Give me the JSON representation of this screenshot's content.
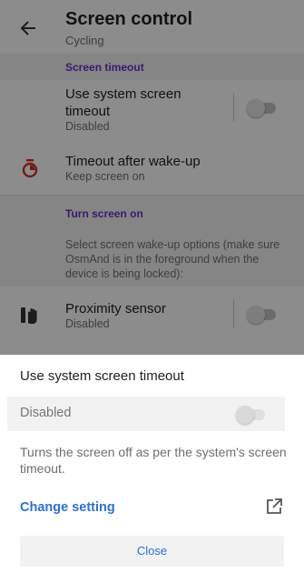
{
  "header": {
    "title": "Screen control",
    "subtitle": "Cycling"
  },
  "sections": {
    "screen_timeout": {
      "header": "Screen timeout",
      "use_system": {
        "title_line1": "Use system screen",
        "title_line2": "timeout",
        "status": "Disabled",
        "enabled": false
      },
      "timeout_after_wakeup": {
        "title": "Timeout after wake-up",
        "status": "Keep screen on"
      }
    },
    "turn_screen_on": {
      "header": "Turn screen on",
      "description": "Select screen wake-up options (make sure OsmAnd is in the foreground when the device is being locked):",
      "proximity": {
        "title": "Proximity sensor",
        "status": "Disabled",
        "enabled": false
      }
    }
  },
  "sheet": {
    "title": "Use system screen timeout",
    "row_label": "Disabled",
    "toggle_enabled": false,
    "description": "Turns the screen off as per the system's screen timeout.",
    "link_label": "Change setting",
    "close_label": "Close"
  },
  "colors": {
    "accent": "#6b32c8",
    "link": "#2f6fd6",
    "timer_icon": "#d32f2f"
  },
  "icons": [
    "arrow-back-icon",
    "timer-icon",
    "hand-proximity-icon",
    "external-link-icon"
  ]
}
